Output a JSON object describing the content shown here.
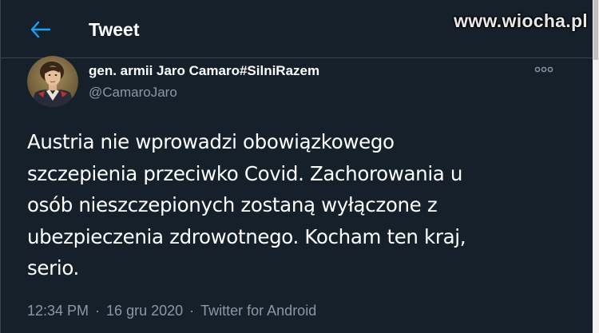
{
  "header": {
    "back_icon": "arrow-left-icon",
    "title": "Tweet",
    "accent_color": "#1da1f2"
  },
  "watermark": {
    "text": "www.wiocha.pl"
  },
  "tweet": {
    "author": {
      "display_name": "gen. armii Jaro Camaro#SilniRazem",
      "handle": "@CamaroJaro",
      "avatar_icon": "portrait-avatar"
    },
    "more_icon": "more-options-icon",
    "text": "Austria nie wprowadzi obowiązkowego\nszczepienia przeciwko Covid. Zachorowania u\nosób nieszczepionych zostaną wyłączone z\nubezpieczenia zdrowotnego. Kocham ten kraj,\nserio.",
    "meta": {
      "time": "12:34 PM",
      "separator": "·",
      "date": "16 gru 2020",
      "source": "Twitter for Android"
    }
  },
  "colors": {
    "background": "#15202b",
    "secondary_text": "#8899a6",
    "divider": "#38444d"
  }
}
